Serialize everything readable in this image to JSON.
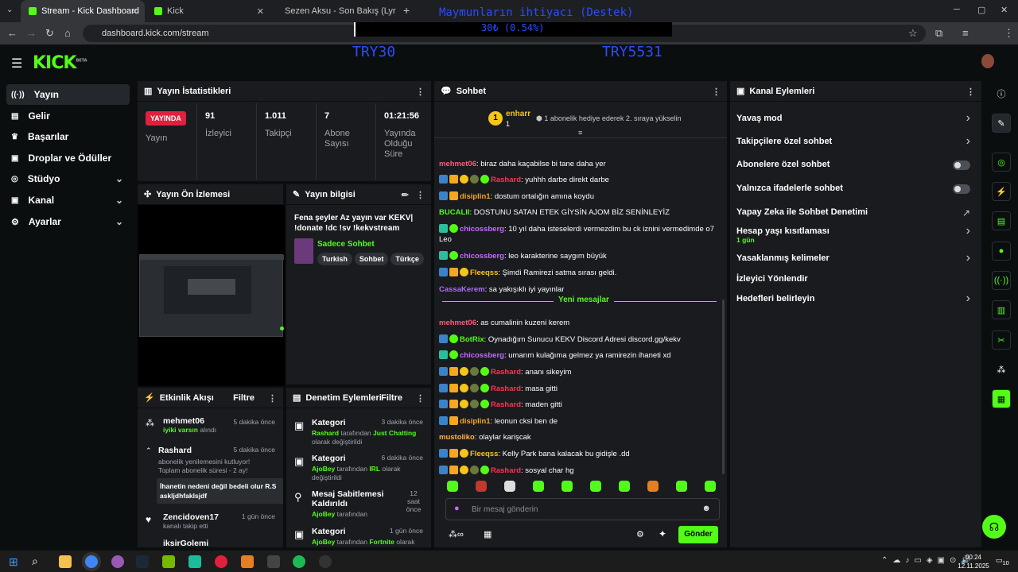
{
  "browser": {
    "tabs": [
      {
        "label": "Stream - Kick Dashboard"
      },
      {
        "label": "Kick"
      },
      {
        "label": "Sezen Aksu - Son Bakış (Lyrics I"
      }
    ],
    "url": "dashboard.kick.com/stream",
    "close": "✕",
    "newtab": "+"
  },
  "overlay": {
    "title": "Maymunların ihtiyacı (Destek)",
    "amount": "30₺ (0.54%)",
    "left_code": "TRY30",
    "right_code": "TRY5531"
  },
  "brand": {
    "logo": "KICK",
    "beta": "BETA"
  },
  "sidebar": {
    "items": [
      {
        "label": "Yayın"
      },
      {
        "label": "Gelir"
      },
      {
        "label": "Başarılar"
      },
      {
        "label": "Droplar ve Ödüller"
      },
      {
        "label": "Stüdyo"
      },
      {
        "label": "Kanal"
      },
      {
        "label": "Ayarlar"
      }
    ]
  },
  "stats": {
    "title": "Yayın İstatistikleri",
    "live_badge": "YAYINDA",
    "live_label": "Yayın",
    "viewers": "91",
    "viewers_label": "İzleyici",
    "followers": "1.011",
    "followers_label": "Takipçi",
    "subs": "7",
    "subs_label": "Abone Sayısı",
    "duration": "01:21:56",
    "duration_label": "Yayında Olduğu Süre"
  },
  "preview": {
    "title": "Yayın Ön İzlemesi"
  },
  "info": {
    "title": "Yayın bilgisi",
    "stream_title": "Fena şeyler Az yayın var KEKV| !donate !dc !sv !kekvstream",
    "category": "Sadece Sohbet",
    "tags": [
      "Turkish",
      "Sohbet",
      "Türkçe"
    ]
  },
  "activity": {
    "title": "Etkinlik Akışı",
    "filter": "Filtre",
    "events": [
      {
        "user": "mehmet06",
        "time": "5 dakika önce",
        "line1": "iyiki varsın",
        "line1b": " alındı"
      },
      {
        "user": "Rashard",
        "time": "5 dakika önce",
        "line1": "abonelik yenilemesini kutluyor!",
        "line2": "Toplam abonelik süresi - 2 ay!",
        "note": "İhanetin nedeni değil bedeli olur R.S askljdhfaklsjdf"
      },
      {
        "user": "Zencidoven17",
        "time": "1 gün önce",
        "line1": "kanalı takip etti"
      },
      {
        "user": "iksirGolemi",
        "time": ""
      }
    ]
  },
  "moderation": {
    "title": "Denetim Eylemleri",
    "filter": "Filtre",
    "actions": [
      {
        "title": "Kategori",
        "time": "3 dakika önce",
        "by": "Rashard",
        "mid": " tarafından ",
        "val": "Just Chatting",
        "tail": "olarak değiştirildi"
      },
      {
        "title": "Kategori",
        "time": "6 dakika önce",
        "by": "AjoBey",
        "mid": " tarafından ",
        "val": "IRL",
        "tail": "olarak değiştirildi"
      },
      {
        "title": "Mesaj Sabitlemesi Kaldırıldı",
        "time": "12 saat önce",
        "by": "AjoBey",
        "mid": " tarafından",
        "val": "",
        "tail": ""
      },
      {
        "title": "Kategori",
        "time": "1 gün önce",
        "by": "AjoBey",
        "mid": " tarafından ",
        "val": "Fortnite",
        "tail": "olarak"
      }
    ]
  },
  "chat": {
    "title": "Sohbet",
    "top_user": "enharr",
    "top_count": "1",
    "promo": "1 abonelik hediye ederek 2. sıraya yükselin",
    "new_messages": "Yeni mesajlar",
    "placeholder": "Bir mesaj gönderin",
    "send": "Gönder",
    "messages": [
      {
        "user": "mehmet06",
        "color": "#ff5a7a",
        "text": ": biraz daha kaçabilse bi tane daha yer",
        "icons": []
      },
      {
        "user": "Rashard",
        "color": "#ff3355",
        "text": ": yuhhh darbe direkt darbe",
        "icons": [
          "bl",
          "gd",
          "yl",
          "ol",
          "gr"
        ]
      },
      {
        "user": "disiplin1",
        "color": "#f5a623",
        "text": ": dostum ortalığın amına koydu",
        "icons": [
          "bl",
          "gd"
        ]
      },
      {
        "user": "BUCALII",
        "color": "#53fc18",
        "text": ": DOSTUNU SATAN ETEK GİYSİN AJOM BİZ SENİNLEYİZ",
        "icons": []
      },
      {
        "user": "chicossberg",
        "color": "#c86bff",
        "text": ": 10 yıl daha isteselerdi vermezdim bu ck iznini vermedimde o7 Leo",
        "icons": [
          "tl",
          "gr"
        ]
      },
      {
        "user": "chicossberg",
        "color": "#c86bff",
        "text": ": leo karakterine saygım büyük",
        "icons": [
          "tl",
          "gr"
        ]
      },
      {
        "user": "Fleeqss",
        "color": "#f5c518",
        "text": ": Şimdi Ramirezi satma sırası geldi.",
        "icons": [
          "bl",
          "gd",
          "yl"
        ]
      },
      {
        "user": "CassaKerem",
        "color": "#b06bff",
        "text": ": sa yakışıklı iyi yayınlar",
        "icons": []
      },
      {
        "user": "mehmet06",
        "color": "#ff5a7a",
        "text": ": as cumalinin kuzeni kerem",
        "icons": []
      },
      {
        "user": "BotRix",
        "color": "#53fc18",
        "text": ": Oynadığım Sunucu KEKV Discord Adresi discord.gg/kekv",
        "icons": [
          "bl",
          "gr"
        ]
      },
      {
        "user": "chicossberg",
        "color": "#c86bff",
        "text": ": umarım kulağıma gelmez ya ramirezin ihaneti xd",
        "icons": [
          "tl",
          "gr"
        ]
      },
      {
        "user": "Rashard",
        "color": "#ff3355",
        "text": ": ananı sikeyim",
        "icons": [
          "bl",
          "gd",
          "yl",
          "ol",
          "gr"
        ]
      },
      {
        "user": "Rashard",
        "color": "#ff3355",
        "text": ": masa gitti",
        "icons": [
          "bl",
          "gd",
          "yl",
          "ol",
          "gr"
        ]
      },
      {
        "user": "Rashard",
        "color": "#ff3355",
        "text": ": maden gitti",
        "icons": [
          "bl",
          "gd",
          "yl",
          "ol",
          "gr"
        ]
      },
      {
        "user": "disiplin1",
        "color": "#f5a623",
        "text": ": leonun cksi ben de",
        "icons": [
          "bl",
          "gd"
        ]
      },
      {
        "user": "mustoliko",
        "color": "#ffb347",
        "text": ": olaylar karişcak",
        "icons": []
      },
      {
        "user": "Fleeqss",
        "color": "#f5c518",
        "text": ": Kelly Park bana kalacak bu gidişle .dd",
        "icons": [
          "bl",
          "gd",
          "yl"
        ]
      },
      {
        "user": "Rashard",
        "color": "#ff3355",
        "text": ": sosyal char hg",
        "icons": [
          "bl",
          "gd",
          "yl",
          "ol",
          "gr"
        ]
      }
    ]
  },
  "channel": {
    "title": "Kanal Eylemleri",
    "items": [
      {
        "label": "Yavaş mod",
        "ctrl": "chev"
      },
      {
        "label": "Takipçilere özel sohbet",
        "ctrl": "chev"
      },
      {
        "label": "Abonelere özel sohbet",
        "ctrl": "toggle"
      },
      {
        "label": "Yalnızca ifadelerle sohbet",
        "ctrl": "toggle"
      },
      {
        "label": "Yapay Zeka ile Sohbet Denetimi",
        "ctrl": "ext"
      },
      {
        "label": "Hesap yaşı kısıtlaması",
        "sub": "1 gün",
        "ctrl": "chev"
      },
      {
        "label": "Yasaklanmış kelimeler",
        "ctrl": "chev"
      },
      {
        "label": "İzleyici Yönlendir",
        "ctrl": "none"
      },
      {
        "label": "Hedefleri belirleyin",
        "ctrl": "chev"
      }
    ]
  },
  "taskbar": {
    "time": "00:24",
    "date": "12.11.2025",
    "notif": "10"
  },
  "colors": {
    "kick_green": "#53fc18",
    "live_red": "#e1203d",
    "panel": "#191b1f",
    "bg": "#0b0e0f"
  }
}
